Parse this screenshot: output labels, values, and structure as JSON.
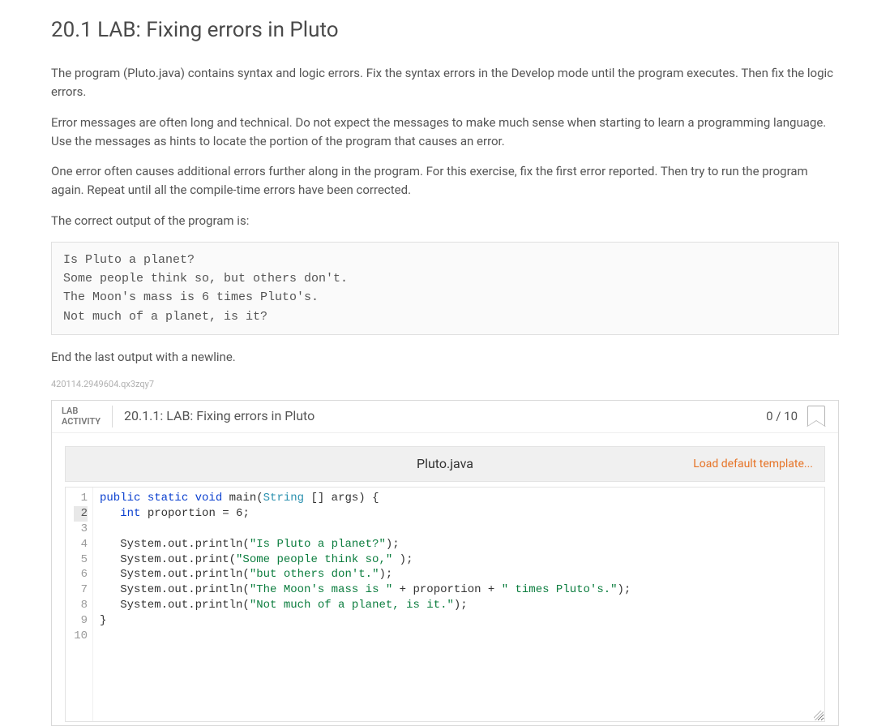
{
  "title": "20.1 LAB: Fixing errors in Pluto",
  "paragraphs": [
    "The program (Pluto.java) contains syntax and logic errors. Fix the syntax errors in the Develop mode until the program executes. Then fix the logic errors.",
    "Error messages are often long and technical. Do not expect the messages to make much sense when starting to learn a programming language. Use the messages as hints to locate the portion of the program that causes an error.",
    "One error often causes additional errors further along in the program. For this exercise, fix the first error reported. Then try to run the program again. Repeat until all the compile-time errors have been corrected.",
    "The correct output of the program is:"
  ],
  "expected_output": "Is Pluto a planet?\nSome people think so, but others don't.\nThe Moon's mass is 6 times Pluto's.\nNot much of a planet, is it?",
  "post_output_note": "End the last output with a newline.",
  "hash_id": "420114.2949604.qx3zqy7",
  "activity": {
    "label_line1": "LAB",
    "label_line2": "ACTIVITY",
    "title": "20.1.1: LAB: Fixing errors in Pluto",
    "score": "0 / 10"
  },
  "file": {
    "name": "Pluto.java",
    "load_default": "Load default template..."
  },
  "editor": {
    "current_line": 2,
    "lines": [
      {
        "n": 1,
        "tokens": [
          {
            "t": "public ",
            "c": "kw"
          },
          {
            "t": "static ",
            "c": "kw"
          },
          {
            "t": "void ",
            "c": "kw"
          },
          {
            "t": "main",
            "c": ""
          },
          {
            "t": "(",
            "c": ""
          },
          {
            "t": "String",
            "c": "type"
          },
          {
            "t": " [] args) {",
            "c": ""
          }
        ]
      },
      {
        "n": 2,
        "tokens": [
          {
            "t": "   ",
            "c": ""
          },
          {
            "t": "int ",
            "c": "kw"
          },
          {
            "t": "proportion = 6;",
            "c": ""
          }
        ]
      },
      {
        "n": 3,
        "tokens": []
      },
      {
        "n": 4,
        "tokens": [
          {
            "t": "   System.out.println(",
            "c": ""
          },
          {
            "t": "\"Is Pluto a planet?\"",
            "c": "str"
          },
          {
            "t": ");",
            "c": ""
          }
        ]
      },
      {
        "n": 5,
        "tokens": [
          {
            "t": "   System.out.print(",
            "c": ""
          },
          {
            "t": "\"Some people think so,\"",
            "c": "str"
          },
          {
            "t": " );",
            "c": ""
          }
        ]
      },
      {
        "n": 6,
        "tokens": [
          {
            "t": "   System.out.println(",
            "c": ""
          },
          {
            "t": "\"but others don't.\"",
            "c": "str"
          },
          {
            "t": ");",
            "c": ""
          }
        ]
      },
      {
        "n": 7,
        "tokens": [
          {
            "t": "   System.out.println(",
            "c": ""
          },
          {
            "t": "\"The Moon's mass is \"",
            "c": "str"
          },
          {
            "t": " + proportion + ",
            "c": ""
          },
          {
            "t": "\" times Pluto's.\"",
            "c": "str"
          },
          {
            "t": ");",
            "c": ""
          }
        ]
      },
      {
        "n": 8,
        "tokens": [
          {
            "t": "   System.out.println(",
            "c": ""
          },
          {
            "t": "\"Not much of a planet, is it.\"",
            "c": "str"
          },
          {
            "t": ");",
            "c": ""
          }
        ]
      },
      {
        "n": 9,
        "tokens": [
          {
            "t": "}",
            "c": ""
          }
        ]
      },
      {
        "n": 10,
        "tokens": []
      }
    ]
  }
}
